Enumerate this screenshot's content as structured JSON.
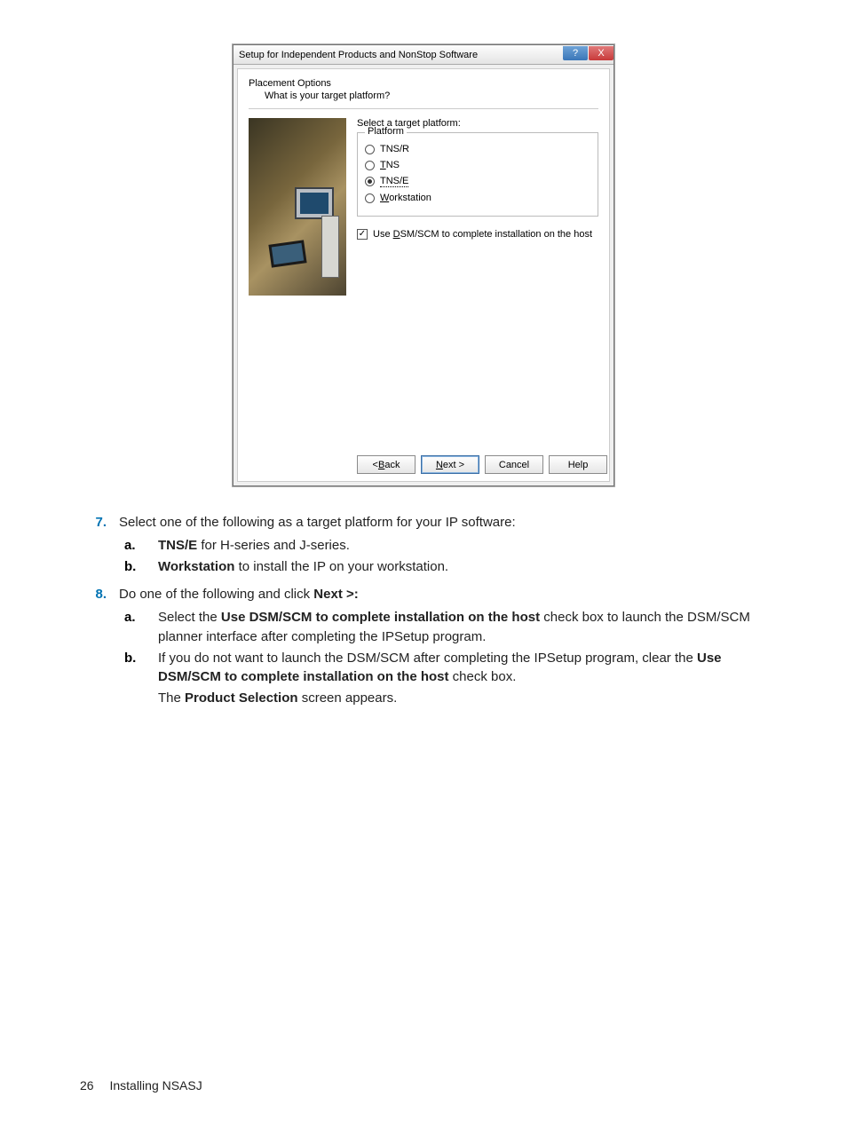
{
  "dialog": {
    "title": "Setup for Independent Products and NonStop Software",
    "heading": "Placement Options",
    "subheading": "What is your target platform?",
    "select_label": "Select a target platform:",
    "group_legend": "Platform",
    "radios": {
      "r1": "TNS/R",
      "r2_pre": "T",
      "r2_rest": "NS",
      "r3": "TNS/E",
      "r4_pre": "W",
      "r4_rest": "orkstation"
    },
    "checkbox_pre": "Use ",
    "checkbox_u": "D",
    "checkbox_rest": "SM/SCM to complete installation on the host",
    "btn_back_pre": "< ",
    "btn_back_u": "B",
    "btn_back_rest": "ack",
    "btn_next_u": "N",
    "btn_next_rest": "ext >",
    "btn_cancel": "Cancel",
    "btn_help": "Help",
    "help_glyph": "?",
    "close_glyph": "X"
  },
  "doc": {
    "step7_num": "7.",
    "step7_text": "Select one of the following as a target platform for your IP software:",
    "s7a_num": "a.",
    "s7a_bold": "TNS/E",
    "s7a_rest": " for H-series and J-series.",
    "s7b_num": "b.",
    "s7b_bold": "Workstation",
    "s7b_rest": " to install the IP on your workstation.",
    "step8_num": "8.",
    "step8_pre": "Do one of the following and click ",
    "step8_bold": "Next >:",
    "s8a_num": "a.",
    "s8a_pre": "Select the ",
    "s8a_bold": "Use DSM/SCM to complete installation on the host",
    "s8a_rest": " check box to launch the DSM/SCM planner interface after completing the IPSetup program.",
    "s8b_num": "b.",
    "s8b_pre": "If you do not want to launch the DSM/SCM after completing the IPSetup program, clear the ",
    "s8b_bold": "Use DSM/SCM to complete installation on the host",
    "s8b_rest": " check box.",
    "s8_after_pre": "The ",
    "s8_after_bold": "Product Selection",
    "s8_after_rest": " screen appears.",
    "footer_page": "26",
    "footer_section": "Installing NSASJ"
  }
}
